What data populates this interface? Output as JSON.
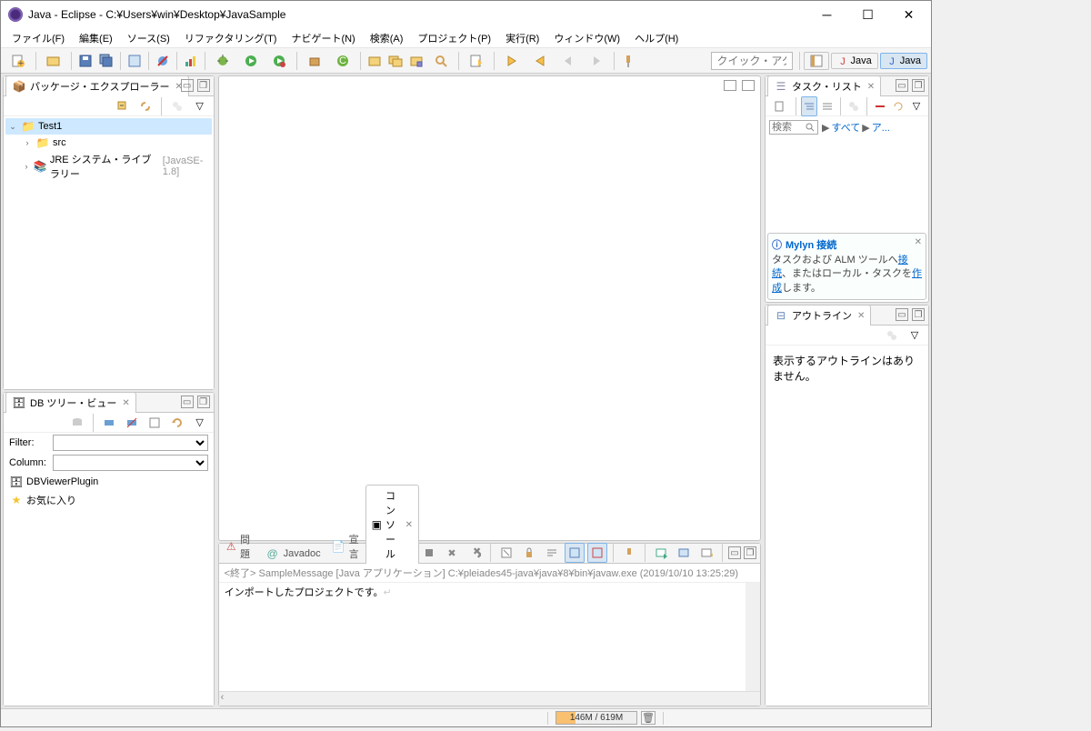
{
  "window": {
    "title": "Java - Eclipse - C:¥Users¥win¥Desktop¥JavaSample"
  },
  "menu": {
    "file": "ファイル(F)",
    "edit": "編集(E)",
    "source": "ソース(S)",
    "refactor": "リファクタリング(T)",
    "navigate": "ナビゲート(N)",
    "search": "検索(A)",
    "project": "プロジェクト(P)",
    "run": "実行(R)",
    "window": "ウィンドウ(W)",
    "help": "ヘルプ(H)"
  },
  "toolbar": {
    "quick_access_placeholder": "クイック・アクセス",
    "perspective_java1": "Java",
    "perspective_java2": "Java"
  },
  "package_explorer": {
    "title": "パッケージ・エクスプローラー",
    "project": "Test1",
    "src": "src",
    "jre": "JRE システム・ライブラリー",
    "jre_meta": "[JavaSE-1.8]"
  },
  "db_view": {
    "title": "DB ツリー・ビュー",
    "filter_label": "Filter:",
    "column_label": "Column:",
    "plugin": "DBViewerPlugin",
    "favorites": "お気に入り"
  },
  "task_list": {
    "title": "タスク・リスト",
    "search_placeholder": "検索",
    "all": "すべて",
    "a": "ア...",
    "mylyn_title": "Mylyn 接続",
    "mylyn_body_1": "タスクおよび ALM ツールへ",
    "mylyn_link_1": "接続",
    "mylyn_body_2": "、またはローカル・タスクを",
    "mylyn_link_2": "作成",
    "mylyn_body_3": "します。"
  },
  "outline": {
    "title": "アウトライン",
    "empty": "表示するアウトラインはありません。"
  },
  "console": {
    "tab_problems": "問題",
    "tab_javadoc": "Javadoc",
    "tab_declaration": "宣言",
    "tab_console": "コンソール",
    "header": "<終了> SampleMessage [Java アプリケーション] C:¥pleiades45-java¥java¥8¥bin¥javaw.exe (2019/10/10 13:25:29)",
    "output": "インポートしたプロジェクトです。"
  },
  "status": {
    "heap": "146M / 619M"
  }
}
